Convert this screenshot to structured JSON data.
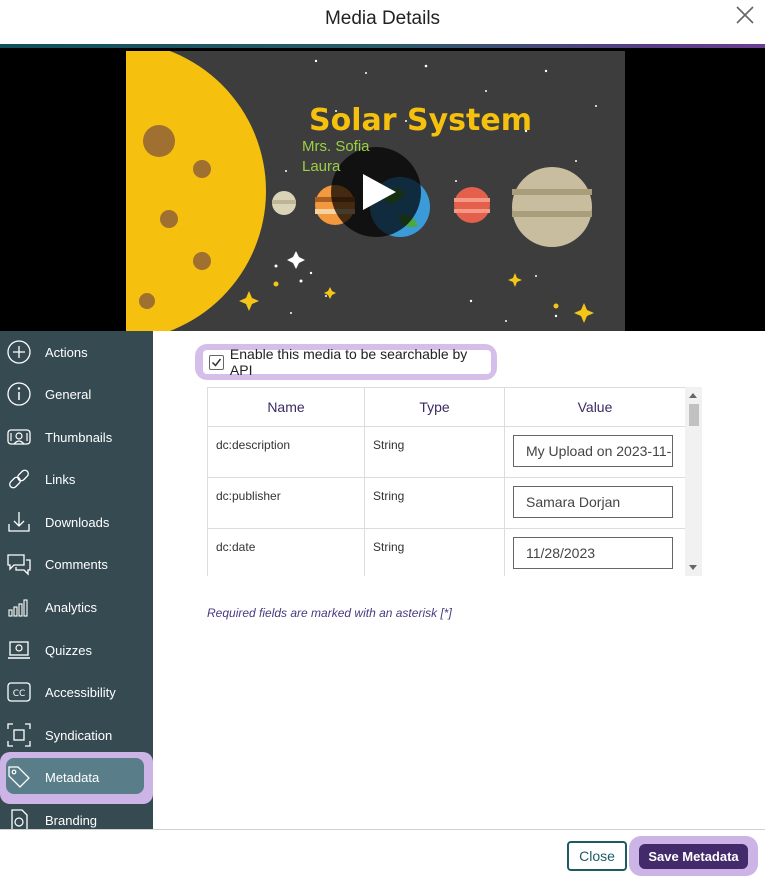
{
  "dialog": {
    "title": "Media Details"
  },
  "video": {
    "title": "Solar System",
    "subtitle_line1": "Mrs. Sofia",
    "subtitle_line2": "Laura"
  },
  "sidebar": {
    "items": [
      {
        "label": "Actions",
        "icon": "plus-circle-icon"
      },
      {
        "label": "General",
        "icon": "info-icon"
      },
      {
        "label": "Thumbnails",
        "icon": "thumbnails-icon"
      },
      {
        "label": "Links",
        "icon": "link-icon"
      },
      {
        "label": "Downloads",
        "icon": "download-icon"
      },
      {
        "label": "Comments",
        "icon": "comments-icon"
      },
      {
        "label": "Analytics",
        "icon": "analytics-icon"
      },
      {
        "label": "Quizzes",
        "icon": "quiz-icon"
      },
      {
        "label": "Accessibility",
        "icon": "cc-icon"
      },
      {
        "label": "Syndication",
        "icon": "syndication-icon"
      },
      {
        "label": "Metadata",
        "icon": "tag-icon"
      },
      {
        "label": "Branding",
        "icon": "branding-icon"
      }
    ],
    "active": "Metadata"
  },
  "api": {
    "label": "Enable this media to be searchable by API",
    "checked": true
  },
  "table": {
    "headers": {
      "name": "Name",
      "type": "Type",
      "value": "Value"
    },
    "rows": [
      {
        "name": "dc:description",
        "type": "String",
        "value": "My Upload on 2023-11-"
      },
      {
        "name": "dc:publisher",
        "type": "String",
        "value": "Samara Dorjan"
      },
      {
        "name": "dc:date",
        "type": "String",
        "value": "11/28/2023"
      }
    ]
  },
  "note": "Required fields are marked with an asterisk [*]",
  "footer": {
    "close_label": "Close",
    "save_label": "Save Metadata"
  },
  "colors": {
    "sidebar_bg": "#364a52",
    "accent": "#432a6a",
    "highlight": "#cdb4e6",
    "teal": "#1d5b63"
  }
}
